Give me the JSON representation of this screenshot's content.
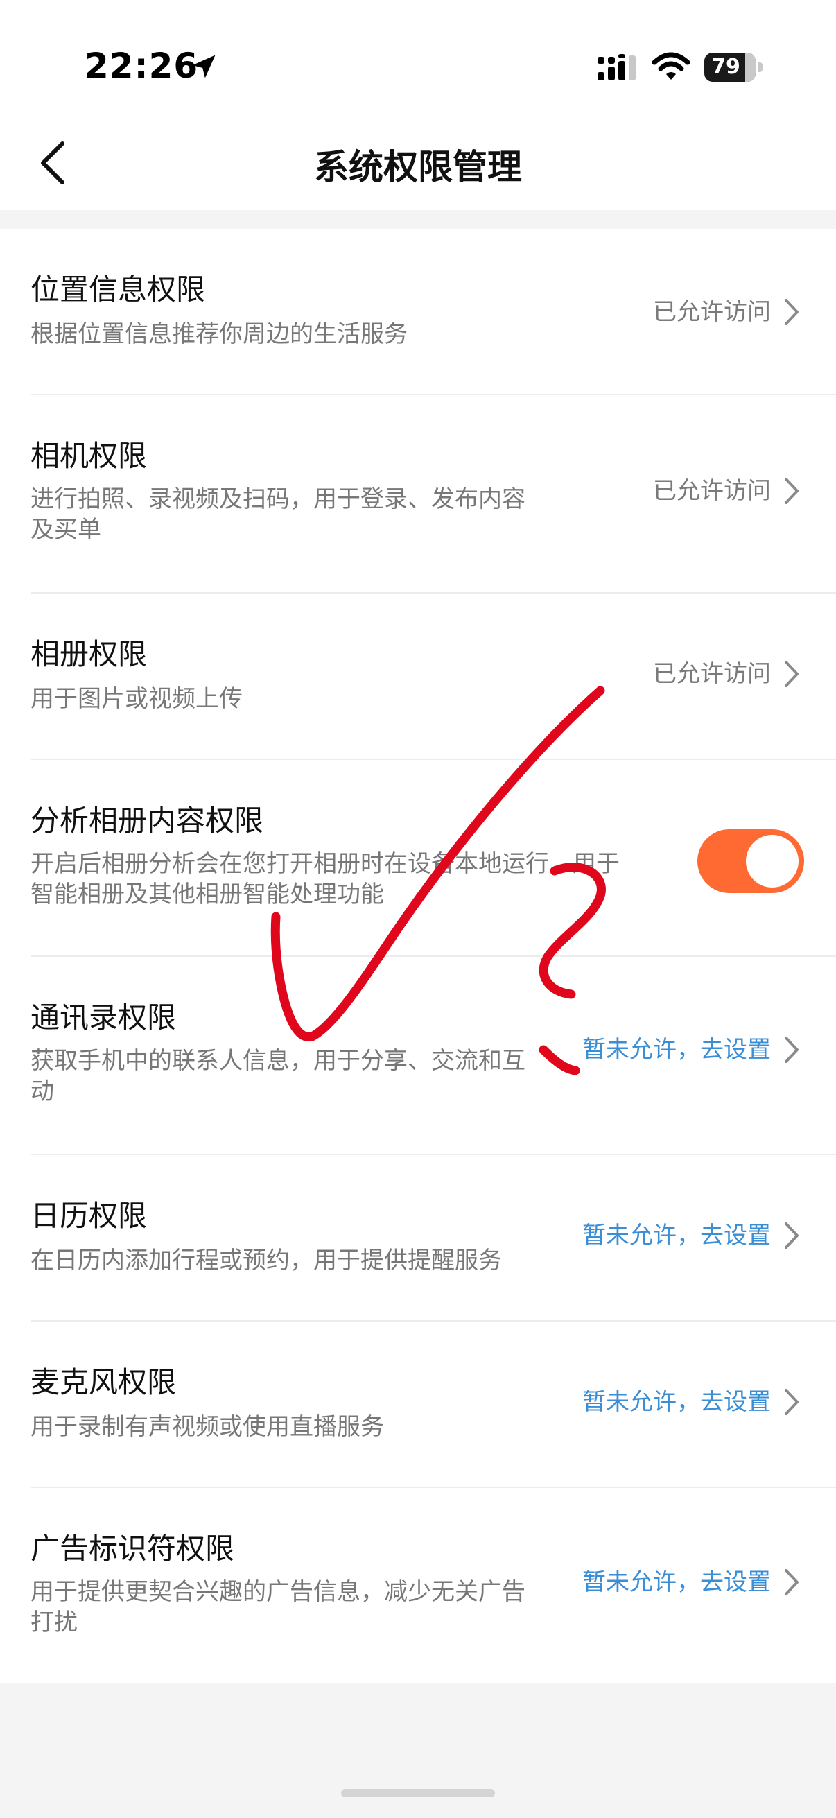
{
  "status_bar": {
    "time": "22:26",
    "battery": "79",
    "icons": [
      "location-arrow-icon",
      "cellular-signal-icon",
      "wifi-icon",
      "battery-icon"
    ]
  },
  "nav": {
    "title": "系统权限管理",
    "back_icon": "chevron-left-icon"
  },
  "permissions": [
    {
      "title": "位置信息权限",
      "desc": "根据位置信息推荐你周边的生活服务",
      "status": "已允许访问",
      "state": "allowed"
    },
    {
      "title": "相机权限",
      "desc": "进行拍照、录视频及扫码，用于登录、发布内容及买单",
      "status": "已允许访问",
      "state": "allowed"
    },
    {
      "title": "相册权限",
      "desc": "用于图片或视频上传",
      "status": "已允许访问",
      "state": "allowed"
    },
    {
      "title": "分析相册内容权限",
      "desc": "开启后相册分析会在您打开相册时在设备本地运行，用于智能相册及其他相册智能处理功能",
      "status": "",
      "state": "toggle-on"
    },
    {
      "title": "通讯录权限",
      "desc": "获取手机中的联系人信息，用于分享、交流和互动",
      "status": "暂未允许，去设置",
      "state": "denied"
    },
    {
      "title": "日历权限",
      "desc": "在日历内添加行程或预约，用于提供提醒服务",
      "status": "暂未允许，去设置",
      "state": "denied"
    },
    {
      "title": "麦克风权限",
      "desc": "用于录制有声视频或使用直播服务",
      "status": "暂未允许，去设置",
      "state": "denied"
    },
    {
      "title": "广告标识符权限",
      "desc": "用于提供更契合兴趣的广告信息，减少无关广告打扰",
      "status": "暂未允许，去设置",
      "state": "denied"
    }
  ],
  "colors": {
    "accent_link": "#3a8ed6",
    "toggle_on": "#ff6a33",
    "annotation_ink": "#e0061b"
  }
}
